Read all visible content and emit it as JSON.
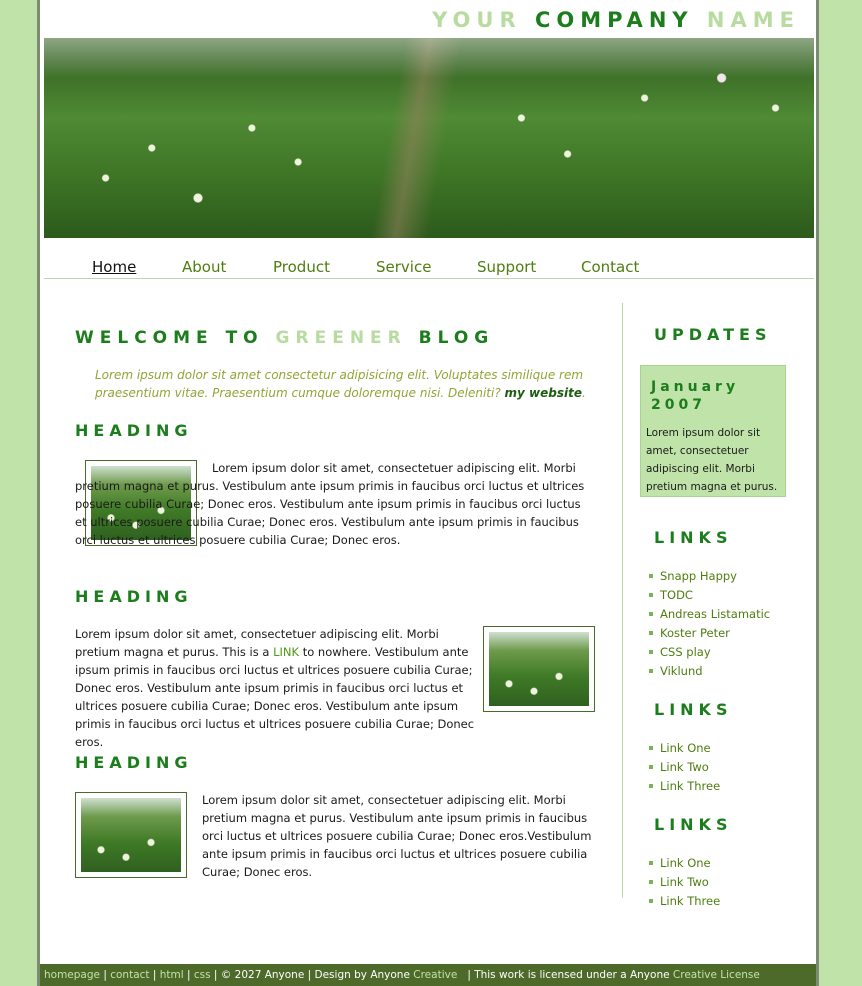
{
  "logo": {
    "word1": "YOUR",
    "word2": "COMPANY",
    "word3": "NAME"
  },
  "nav": [
    {
      "label": "Home",
      "active": true
    },
    {
      "label": "About"
    },
    {
      "label": "Product"
    },
    {
      "label": "Service"
    },
    {
      "label": "Support"
    },
    {
      "label": "Contact"
    }
  ],
  "main": {
    "title": {
      "part1": "WELCOME TO",
      "part2": "GREENER",
      "part3": "BLOG"
    },
    "intro": "Lorem ipsum dolor sit amet consectetur adipisicing elit. Voluptates similique rem praesentium vitae. Praesentium cumque doloremque nisi. Deleniti?",
    "intro_link": "my website",
    "intro_end": ".",
    "sections": [
      {
        "heading": "HEADING",
        "text": "Lorem ipsum dolor sit amet, consectetuer adipiscing elit. Morbi pretium magna et purus. Vestibulum ante ipsum primis in faucibus orci luctus et ultrices posuere cubilia Curae; Donec eros. Vestibulum ante ipsum primis in faucibus orci luctus et ultrices posuere cubilia Curae; Donec eros. Vestibulum ante ipsum primis in faucibus orci luctus et ultrices posuere cubilia Curae; Donec eros."
      },
      {
        "heading": "HEADING",
        "text_before": "Lorem ipsum dolor sit amet, consectetuer adipiscing elit. Morbi pretium magna et purus. This is a",
        "link": "LINK",
        "text_after": "to nowhere. Vestibulum ante ipsum primis in faucibus orci luctus et ultrices posuere cubilia Curae; Donec eros. Vestibulum ante ipsum primis in faucibus orci luctus et ultrices posuere cubilia Curae; Donec eros. Vestibulum ante ipsum primis in faucibus orci luctus et ultrices posuere cubilia Curae; Donec eros."
      },
      {
        "heading": "HEADING",
        "text": "Lorem ipsum dolor sit amet, consectetuer adipiscing elit. Morbi pretium magna et purus. Vestibulum ante ipsum primis in faucibus orci luctus et ultrices posuere cubilia Curae; Donec eros.Vestibulum ante ipsum primis in faucibus orci luctus et ultrices posuere cubilia Curae; Donec eros."
      }
    ]
  },
  "sidebar": {
    "updates_heading": "UPDATES",
    "update_date": "January 2007",
    "update_text": "Lorem ipsum dolor sit amet, consectetuer adipiscing elit. Morbi pretium magna et purus.",
    "link_groups": [
      {
        "heading": "LINKS",
        "items": [
          "Snapp Happy",
          "TODC",
          "Andreas Listamatic",
          "Koster Peter",
          "CSS play",
          "Viklund"
        ]
      },
      {
        "heading": "LINKS",
        "items": [
          "Link One",
          "Link Two",
          "Link Three"
        ]
      },
      {
        "heading": "LINKS",
        "items": [
          "Link One",
          "Link Two",
          "Link Three"
        ]
      }
    ]
  },
  "footer": {
    "links": [
      "homepage",
      "html",
      "css"
    ],
    "contact": "contact",
    "copyright": "© 2027 Anyone | Design by",
    "designer": "Anyone",
    "creative1": "Creative",
    "license_text": "| This work is licensed under a Anyone",
    "creative2": "Creative",
    "license": "License"
  },
  "colors": {
    "accent": "#1c7d1c",
    "light": "#b8dba0",
    "background": "#bfe3a8",
    "footer": "#4e6a2a"
  }
}
